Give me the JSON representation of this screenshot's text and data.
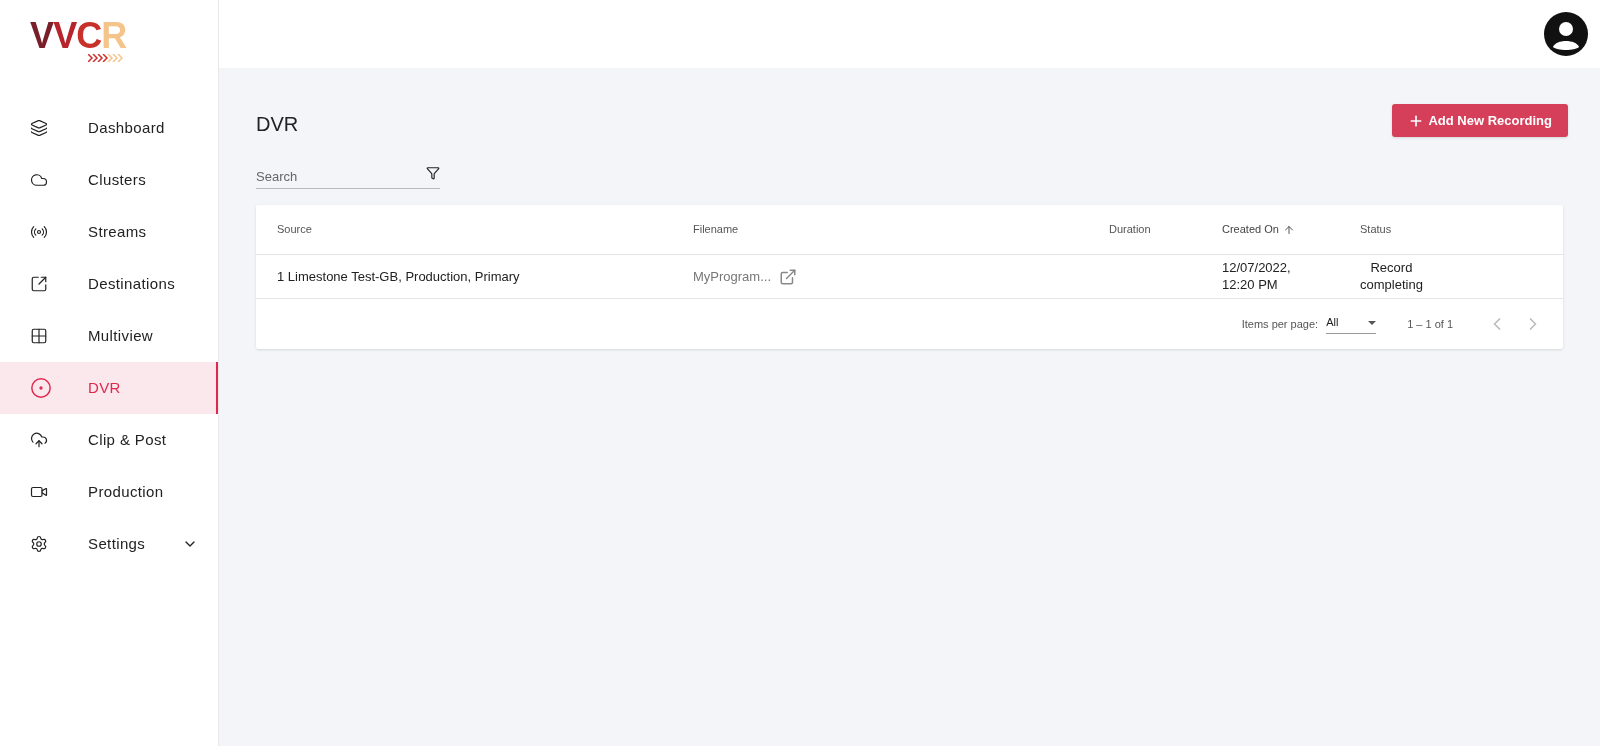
{
  "logo": "VVCR",
  "sidebar": {
    "items": [
      {
        "label": "Dashboard",
        "selected": false
      },
      {
        "label": "Clusters",
        "selected": false
      },
      {
        "label": "Streams",
        "selected": false
      },
      {
        "label": "Destinations",
        "selected": false
      },
      {
        "label": "Multiview",
        "selected": false
      },
      {
        "label": "DVR",
        "selected": true
      },
      {
        "label": "Clip & Post",
        "selected": false
      },
      {
        "label": "Production",
        "selected": false
      },
      {
        "label": "Settings",
        "selected": false,
        "expanded": false
      }
    ]
  },
  "page": {
    "title": "DVR",
    "add_button": "Add New Recording"
  },
  "search": {
    "placeholder": "Search"
  },
  "table": {
    "columns": [
      {
        "label": "Source",
        "sorted": false
      },
      {
        "label": "Filename",
        "sorted": false
      },
      {
        "label": "Duration",
        "sorted": false
      },
      {
        "label": "Created On",
        "sorted": true
      },
      {
        "label": "Status",
        "sorted": false
      }
    ],
    "rows": [
      {
        "source": "1 Limestone Test-GB, Production, Primary",
        "filename": "MyProgram...",
        "created_on": [
          "12/07/2022,",
          "12:20 PM"
        ],
        "status": [
          "Record",
          "completing"
        ]
      }
    ]
  },
  "paginator": {
    "items_label": "Items per page:",
    "items_value": "All",
    "range": "1 – 1 of 1"
  }
}
